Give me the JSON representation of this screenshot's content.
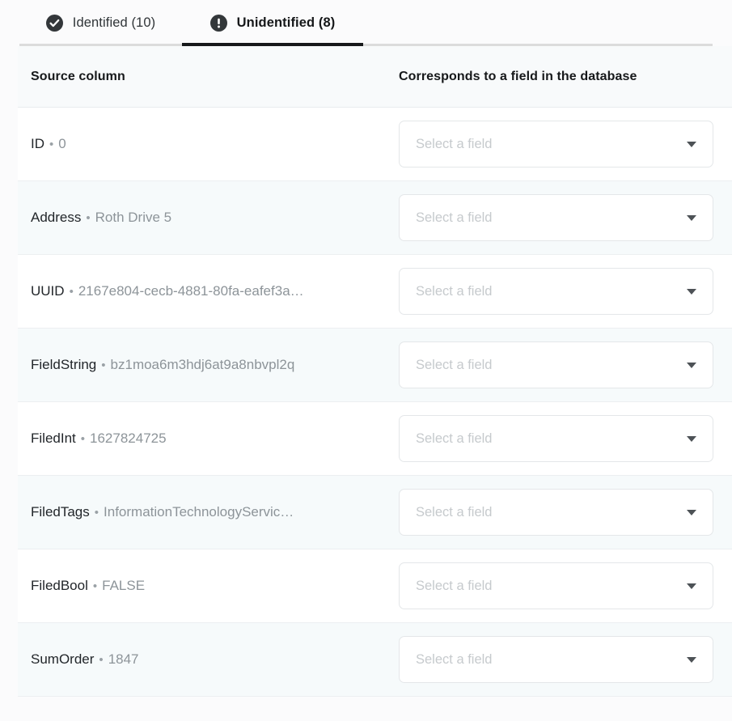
{
  "tabs": [
    {
      "id": "identified",
      "label": "Identified (10)",
      "icon": "check-circle-icon",
      "active": false
    },
    {
      "id": "unidentified",
      "label": "Unidentified (8)",
      "icon": "exclamation-circle-icon",
      "active": true
    }
  ],
  "table": {
    "headers": {
      "source": "Source column",
      "target": "Corresponds to a field in the database"
    },
    "select_placeholder": "Select a field",
    "separator": "•",
    "rows": [
      {
        "name": "ID",
        "value": "0"
      },
      {
        "name": "Address",
        "value": "Roth Drive 5"
      },
      {
        "name": "UUID",
        "value": "2167e804-cecb-4881-80fa-eafef3a…"
      },
      {
        "name": "FieldString",
        "value": "bz1moa6m3hdj6at9a8nbvpl2q"
      },
      {
        "name": "FiledInt",
        "value": "1627824725"
      },
      {
        "name": "FiledTags",
        "value": "InformationTechnologyServic…"
      },
      {
        "name": "FiledBool",
        "value": "FALSE"
      },
      {
        "name": "SumOrder",
        "value": "1847"
      }
    ]
  },
  "colors": {
    "accent": "#17191b",
    "page_background": "#fbfbfc",
    "row_alt_background": "#f6fafb",
    "header_background": "#f8fafb",
    "muted_text": "#8d9499",
    "placeholder_text": "#c6cacd"
  }
}
